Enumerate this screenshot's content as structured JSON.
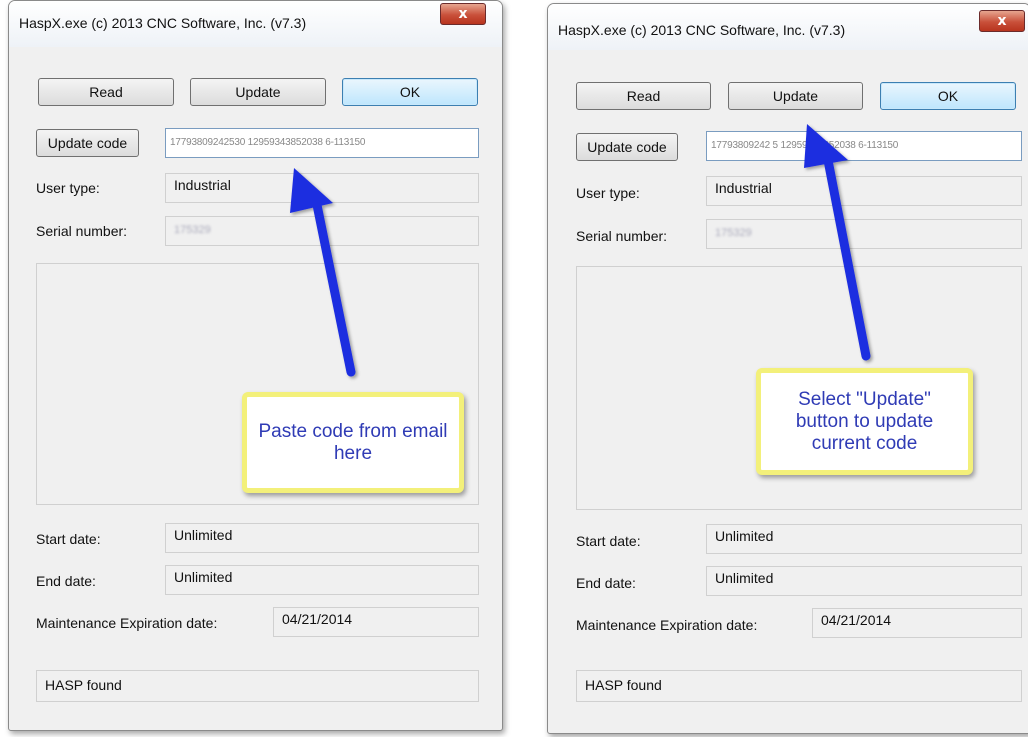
{
  "colors": {
    "arrow": "#1f2fe0",
    "callout_border": "#f3f07a",
    "callout_text": "#2f3bb5"
  },
  "left": {
    "title": "HaspX.exe (c) 2013 CNC Software, Inc. (v7.3)",
    "close_label": "x",
    "read_label": "Read",
    "update_label": "Update",
    "ok_label": "OK",
    "update_code_label": "Update code",
    "update_code_value": "17793809242530 12959343852038 6-113150",
    "user_type_label": "User type:",
    "user_type_value": "Industrial",
    "serial_label": "Serial number:",
    "serial_value": "175329",
    "start_label": "Start date:",
    "start_value": "Unlimited",
    "end_label": "End date:",
    "end_value": "Unlimited",
    "maint_label": "Maintenance Expiration date:",
    "maint_value": "04/21/2014",
    "status": "HASP found",
    "callout": "Paste code from email here"
  },
  "right": {
    "title": "HaspX.exe (c) 2013 CNC Software, Inc. (v7.3)",
    "close_label": "x",
    "read_label": "Read",
    "update_label": "Update",
    "ok_label": "OK",
    "update_code_label": "Update code",
    "update_code_value": "17793809242 5 12959343852038 6-113150",
    "user_type_label": "User type:",
    "user_type_value": "Industrial",
    "serial_label": "Serial number:",
    "serial_value": "175329",
    "start_label": "Start date:",
    "start_value": "Unlimited",
    "end_label": "End date:",
    "end_value": "Unlimited",
    "maint_label": "Maintenance Expiration date:",
    "maint_value": "04/21/2014",
    "status": "HASP found",
    "callout": "Select \"Update\" button to update current code"
  }
}
